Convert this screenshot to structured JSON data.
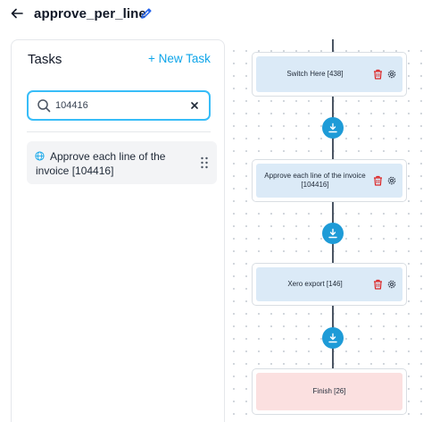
{
  "header": {
    "title": "approve_per_line"
  },
  "tasks_panel": {
    "title": "Tasks",
    "new_task_label": "+ New Task",
    "search": {
      "value": "104416",
      "placeholder": ""
    },
    "task_item": {
      "label": "Approve each line of the invoice [104416]"
    }
  },
  "flow": {
    "nodes": [
      {
        "label": "Switch Here [438]"
      },
      {
        "label": "Approve each line of the invoice [104416]"
      },
      {
        "label": "Xero export [146]"
      },
      {
        "label": "Finish [26]"
      }
    ]
  },
  "colors": {
    "accent": "#0ea5e9",
    "add_button": "#1e9bd7",
    "node_fill": "#dbeaf7",
    "finish_fill": "#fbe0e0",
    "delete_icon": "#dc2626"
  },
  "icons": {
    "back": "arrow-left-icon",
    "edit": "pencil-icon",
    "search": "search-icon",
    "clear": "close-icon",
    "task": "globe-icon",
    "drag": "drag-handle-icon",
    "delete": "trash-icon",
    "settings": "gear-icon",
    "add_step": "download-arrow-icon"
  }
}
